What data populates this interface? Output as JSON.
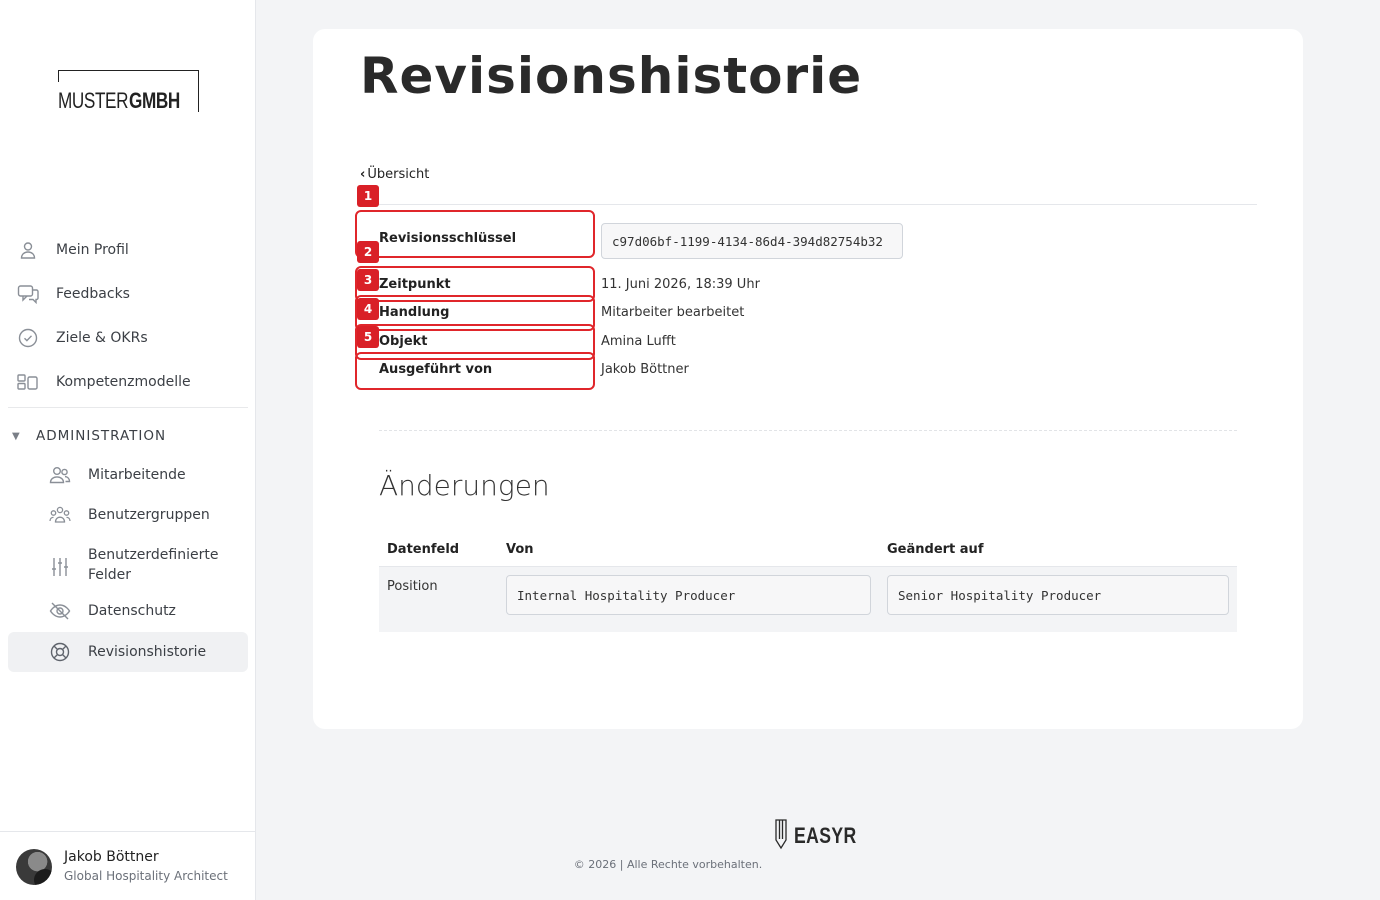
{
  "brand": {
    "logo_part1": "MUSTER",
    "logo_part2": "GMBH"
  },
  "sidebar": {
    "items": [
      {
        "label": "Mein Profil",
        "icon": "user-icon"
      },
      {
        "label": "Feedbacks",
        "icon": "chat-icon"
      },
      {
        "label": "Ziele & OKRs",
        "icon": "check-circle-icon"
      },
      {
        "label": "Kompetenzmodelle",
        "icon": "layout-icon"
      }
    ],
    "section": {
      "label": "ADMINISTRATION",
      "icon": "triangle-down-icon"
    },
    "sub_items": [
      {
        "label": "Mitarbeitende",
        "icon": "users-icon"
      },
      {
        "label": "Benutzergruppen",
        "icon": "group-icon"
      },
      {
        "label": "Benutzerdefinierte Felder",
        "icon": "sliders-icon"
      },
      {
        "label": "Datenschutz",
        "icon": "eye-off-icon"
      },
      {
        "label": "Revisionshistorie",
        "icon": "lifebuoy-icon",
        "active": true
      }
    ]
  },
  "user": {
    "name": "Jakob Böttner",
    "role": "Global Hospitality Architect"
  },
  "page": {
    "title": "Revisionshistorie",
    "back_label": "Übersicht",
    "details": {
      "key_label": "Revisionsschlüssel",
      "key_value": "c97d06bf-1199-4134-86d4-394d82754b32",
      "time_label": "Zeitpunkt",
      "time_value": "11. Juni 2026, 18:39 Uhr",
      "action_label": "Handlung",
      "action_value": "Mitarbeiter bearbeitet",
      "object_label": "Objekt",
      "object_value": "Amina Lufft",
      "by_label": "Ausgeführt von",
      "by_value": "Jakob Böttner"
    },
    "changes": {
      "title": "Änderungen",
      "headers": {
        "field": "Datenfeld",
        "from": "Von",
        "to": "Geändert auf"
      },
      "rows": [
        {
          "field": "Position",
          "from": "Internal Hospitality Producer",
          "to": "Senior Hospitality Producer"
        }
      ]
    }
  },
  "annotations": [
    "1",
    "2",
    "3",
    "4",
    "5"
  ],
  "footer": {
    "brand": "EASYR",
    "copyright": "© 2026 | Alle Rechte vorbehalten."
  },
  "colors": {
    "annotation": "#e0262b",
    "active_bg": "#f0f1f3"
  }
}
